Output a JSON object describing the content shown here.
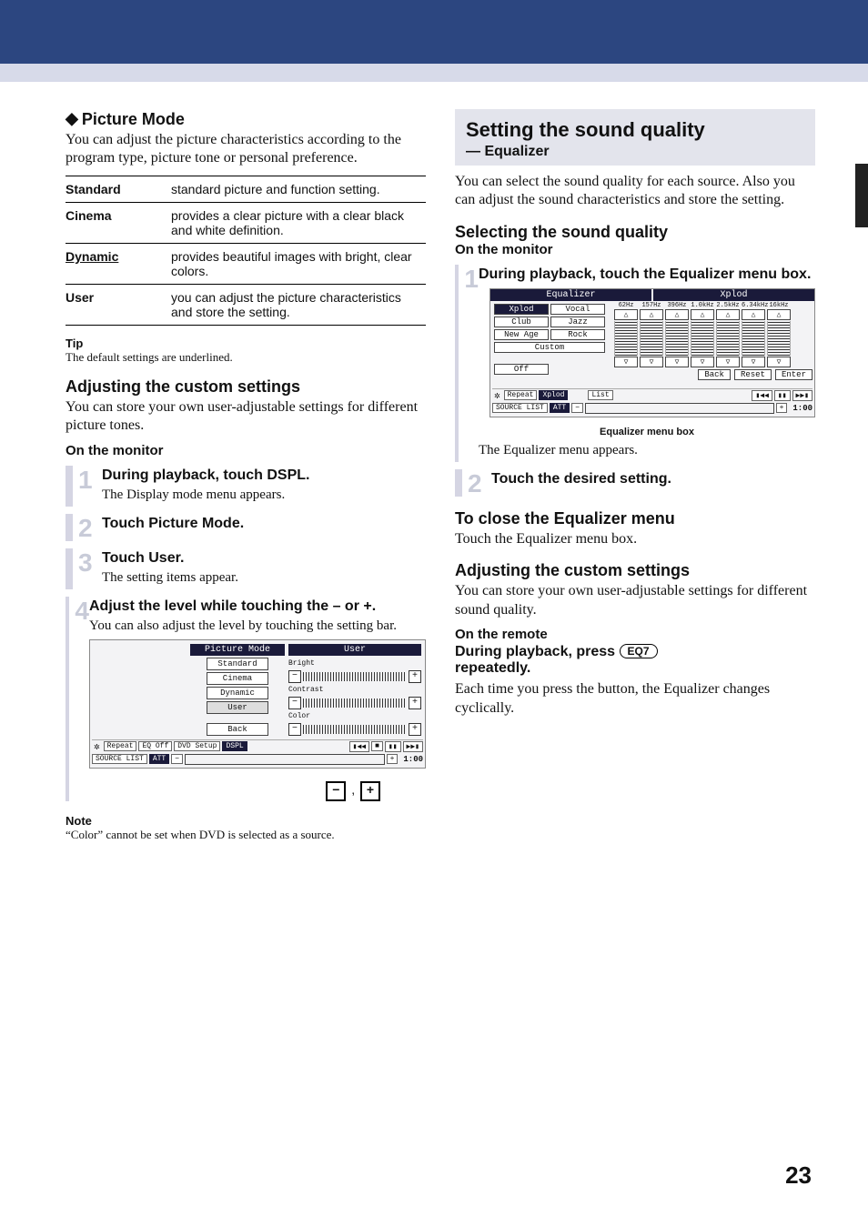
{
  "left": {
    "picture_mode_heading": "Picture Mode",
    "picture_mode_text": "You can adjust the picture characteristics according to the program type, picture tone or personal preference.",
    "modes": [
      {
        "key": "Standard",
        "desc": "standard picture and function setting.",
        "underline": false
      },
      {
        "key": "Cinema",
        "desc": "provides a clear picture with a clear black and white definition.",
        "underline": false
      },
      {
        "key": "Dynamic",
        "desc": "provides beautiful images with bright, clear colors.",
        "underline": true
      },
      {
        "key": "User",
        "desc": "you can adjust the picture characteristics and store the setting.",
        "underline": false
      }
    ],
    "tip_label": "Tip",
    "tip_text": "The default settings are underlined.",
    "adjust_heading": "Adjusting the custom settings",
    "adjust_text": "You can store your own user-adjustable settings for different picture tones.",
    "on_monitor": "On the monitor",
    "step1_title": "During playback, touch DSPL.",
    "step1_desc": "The Display mode menu appears.",
    "step2_title": "Touch Picture Mode.",
    "step3_title": "Touch User.",
    "step3_desc": "The setting items appear.",
    "step4_title": "Adjust the level while touching the – or +.",
    "step4_desc": "You can also adjust the level by touching the setting bar.",
    "osd_left_title": "Picture Mode",
    "osd_right_title": "User",
    "osd_buttons": [
      "Standard",
      "Cinema",
      "Dynamic",
      "User",
      "Back"
    ],
    "osd_sliders": [
      "Bright",
      "Contrast",
      "Color"
    ],
    "osd_bottom_chips": [
      "Repeat",
      "EQ Off",
      "DVD Setup",
      "DSPL"
    ],
    "osd_src": "SOURCE LIST",
    "osd_att": "ATT",
    "osd_time": "1:00",
    "plusminus_sep": ",",
    "note_label": "Note",
    "note_text": "“Color” cannot be set when DVD is selected as a source."
  },
  "right": {
    "main_title": "Setting the sound quality",
    "subtitle": "— Equalizer",
    "intro": "You can select the sound quality for each source. Also you can adjust the sound characteristics and store the setting.",
    "select_heading": "Selecting the sound quality",
    "on_monitor": "On the monitor",
    "step1_title": "During playback, touch the Equalizer menu box.",
    "eq_title_left": "Equalizer",
    "eq_title_right": "Xplod",
    "eq_presets": [
      "Xplod",
      "Vocal",
      "Club",
      "Jazz",
      "New Age",
      "Rock",
      "Custom"
    ],
    "eq_off": "Off",
    "eq_freqs": [
      "62Hz",
      "157Hz",
      "396Hz",
      "1.0kHz",
      "2.5kHz",
      "6.34kHz",
      "16kHz"
    ],
    "eq_actions": [
      "Back",
      "Reset",
      "Enter"
    ],
    "eq_bottom_chips": [
      "Repeat",
      "Xplod",
      "List"
    ],
    "eq_src": "SOURCE LIST",
    "eq_att": "ATT",
    "eq_time": "1:00",
    "eq_caption": "Equalizer menu box",
    "step1_after": "The Equalizer menu appears.",
    "step2_title": "Touch the desired setting.",
    "close_heading": "To close the Equalizer menu",
    "close_text": "Touch the Equalizer menu box.",
    "adj_heading": "Adjusting the custom settings",
    "adj_text": "You can store your own user-adjustable settings for different sound quality.",
    "on_remote": "On the remote",
    "remote_line_a": "During playback, press ",
    "eq7": "EQ7",
    "remote_line_b": "repeatedly.",
    "remote_after": "Each time you press the button, the Equalizer changes cyclically."
  },
  "nums": {
    "s1": "1",
    "s2": "2",
    "s3": "3",
    "s4": "4"
  },
  "page": "23"
}
